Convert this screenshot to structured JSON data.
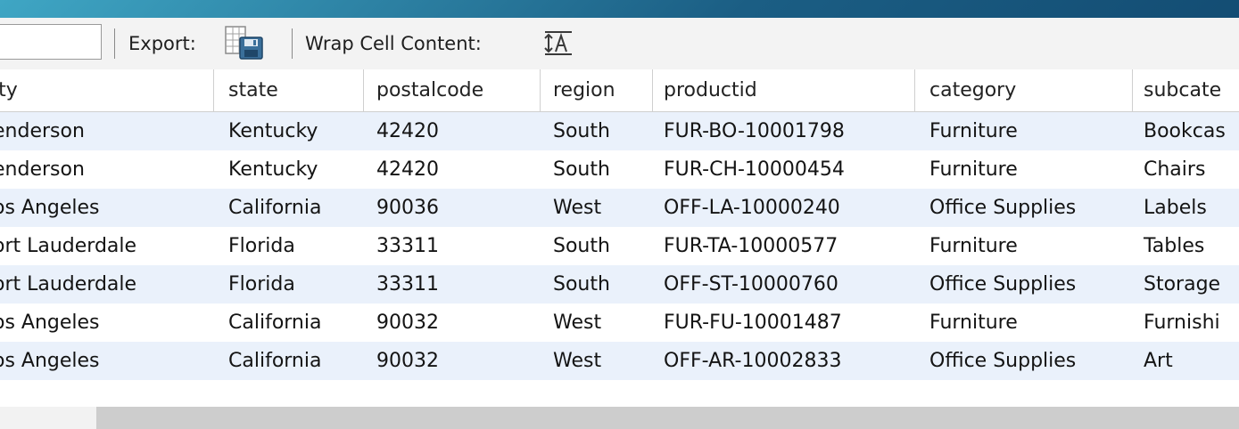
{
  "toolbar": {
    "filter_value": "",
    "export_label": "Export:",
    "wrap_label": "Wrap Cell Content:",
    "icons": {
      "export": "export-to-file-icon",
      "wrap": "wrap-text-icon"
    }
  },
  "grid": {
    "columns": [
      "city",
      "state",
      "postalcode",
      "region",
      "productid",
      "category",
      "subcategory"
    ],
    "column_display": [
      "ity",
      "state",
      "postalcode",
      "region",
      "productid",
      "category",
      "subcate"
    ],
    "rows": [
      {
        "display": [
          "enderson",
          "Kentucky",
          "42420",
          "South",
          "FUR-BO-10001798",
          "Furniture",
          "Bookcas"
        ]
      },
      {
        "display": [
          "enderson",
          "Kentucky",
          "42420",
          "South",
          "FUR-CH-10000454",
          "Furniture",
          "Chairs"
        ]
      },
      {
        "display": [
          "os Angeles",
          "California",
          "90036",
          "West",
          "OFF-LA-10000240",
          "Office Supplies",
          "Labels"
        ]
      },
      {
        "display": [
          "ort Lauderdale",
          "Florida",
          "33311",
          "South",
          "FUR-TA-10000577",
          "Furniture",
          "Tables"
        ]
      },
      {
        "display": [
          "ort Lauderdale",
          "Florida",
          "33311",
          "South",
          "OFF-ST-10000760",
          "Office Supplies",
          "Storage"
        ]
      },
      {
        "display": [
          "os Angeles",
          "California",
          "90032",
          "West",
          "FUR-FU-10001487",
          "Furniture",
          "Furnishi"
        ]
      },
      {
        "display": [
          "os Angeles",
          "California",
          "90032",
          "West",
          "OFF-AR-10002833",
          "Office Supplies",
          "Art"
        ]
      }
    ]
  },
  "colors": {
    "alt_row": "#eaf1fb",
    "toolbar_bg": "#f3f3f3",
    "scroll_thumb": "#cdcdcd"
  }
}
